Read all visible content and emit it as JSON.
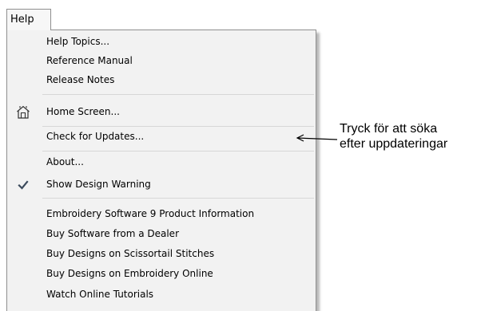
{
  "menubar": {
    "help_label": "Help"
  },
  "menu": {
    "items": [
      {
        "label": "Help Topics..."
      },
      {
        "label": "Reference Manual"
      },
      {
        "label": "Release Notes"
      },
      {
        "label": "Home Screen...",
        "icon": "home-screen-icon"
      },
      {
        "label": "Check for Updates..."
      },
      {
        "label": "About..."
      },
      {
        "label": "Show Design Warning",
        "icon": "checkmark-icon",
        "checked": true
      },
      {
        "label": "Embroidery Software 9 Product Information"
      },
      {
        "label": "Buy Software from a Dealer"
      },
      {
        "label": "Buy Designs on Scissortail Stitches"
      },
      {
        "label": "Buy Designs on Embroidery Online"
      },
      {
        "label": "Watch Online Tutorials"
      }
    ]
  },
  "annotation": {
    "line1": "Tryck för att söka",
    "line2": "efter uppdateringar"
  },
  "colors": {
    "menu_background": "#f2f2f2",
    "menu_border": "#8f8f8f",
    "separator": "#d7d7d7",
    "checkmark": "#3b4a5c"
  }
}
